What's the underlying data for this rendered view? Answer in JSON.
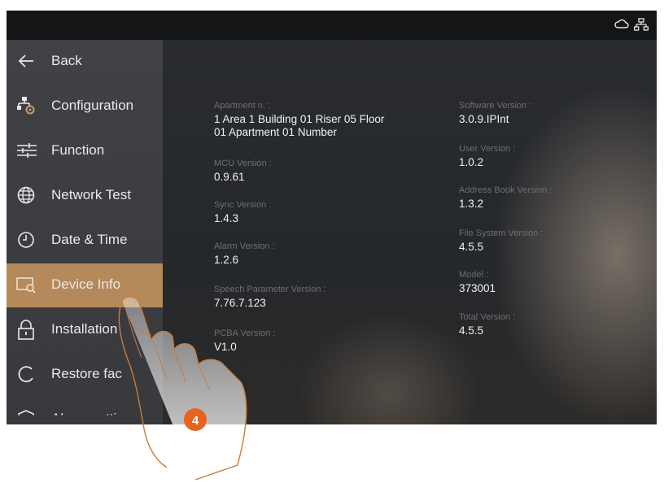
{
  "sidebar": {
    "items": [
      {
        "label": "Back",
        "icon": "arrow-left-icon"
      },
      {
        "label": "Configuration",
        "icon": "configuration-icon"
      },
      {
        "label": "Function",
        "icon": "sliders-icon"
      },
      {
        "label": "Network Test",
        "icon": "globe-icon"
      },
      {
        "label": "Date & Time",
        "icon": "clock-icon"
      },
      {
        "label": "Device Info",
        "icon": "device-info-icon"
      },
      {
        "label": "Installation",
        "icon": "lock-icon"
      },
      {
        "label": "Restore fac",
        "icon": "restore-icon"
      },
      {
        "label": "Alarm setti",
        "icon": "shield-icon"
      }
    ],
    "active_index": 5
  },
  "info": {
    "left": [
      {
        "key": "Apartment n. :",
        "value": "1 Area 1 Building 01 Riser 05 Floor\n01 Apartment 01 Number"
      },
      {
        "key": "MCU Version :",
        "value": "0.9.61"
      },
      {
        "key": "Sync Version :",
        "value": "1.4.3"
      },
      {
        "key": "Alarm Version :",
        "value": "1.2.6"
      },
      {
        "key": "Speech Parameter Version :",
        "value": "7.76.7.123"
      },
      {
        "key": "PCBA Version :",
        "value": "V1.0"
      }
    ],
    "right": [
      {
        "key": "Software Version :",
        "value": "3.0.9.IPInt"
      },
      {
        "key": "User Version :",
        "value": "1.0.2"
      },
      {
        "key": "Address Book Version :",
        "value": "1.3.2"
      },
      {
        "key": "File System Version :",
        "value": "4.5.5"
      },
      {
        "key": "Model :",
        "value": "373001"
      },
      {
        "key": "Total Version :",
        "value": "4.5.5"
      }
    ]
  },
  "step_badge": "4",
  "colors": {
    "accent": "#b48a5a",
    "badge": "#e8641e"
  }
}
